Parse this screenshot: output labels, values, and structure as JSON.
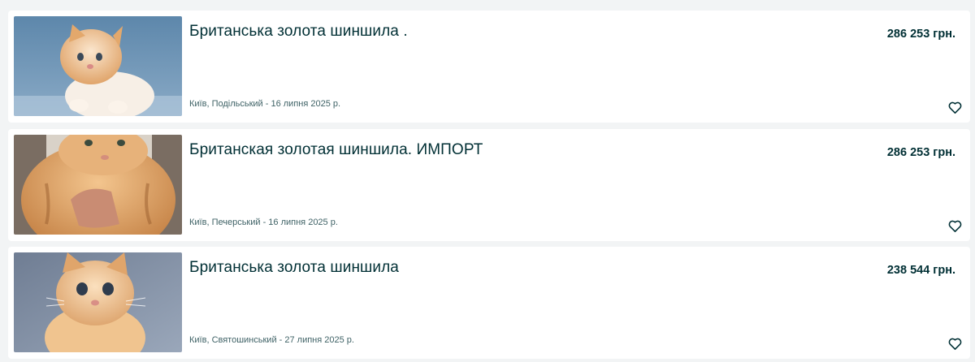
{
  "listings": [
    {
      "title": "Британська золота шиншила .",
      "price": "286 253 грн.",
      "location_date": "Київ, Подільський - 16 липня 2025 р.",
      "image_alt": "golden kitten on blue background",
      "favorite_icon": "heart-outline-icon"
    },
    {
      "title": "Британская золотая шиншила. ИМПОРТ",
      "price": "286 253 грн.",
      "location_date": "Київ, Печерський - 16 липня 2025 р.",
      "image_alt": "golden cat held in hands",
      "favorite_icon": "heart-outline-icon"
    },
    {
      "title": "Британська золота шиншила",
      "price": "238 544 грн.",
      "location_date": "Київ, Святошинський - 27 липня 2025 р.",
      "image_alt": "golden kitten on grey background",
      "favorite_icon": "heart-outline-icon"
    }
  ],
  "colors": {
    "page_background": "#f2f4f5",
    "card_background": "#ffffff",
    "text_primary": "#002f34",
    "text_secondary": "#406367"
  }
}
